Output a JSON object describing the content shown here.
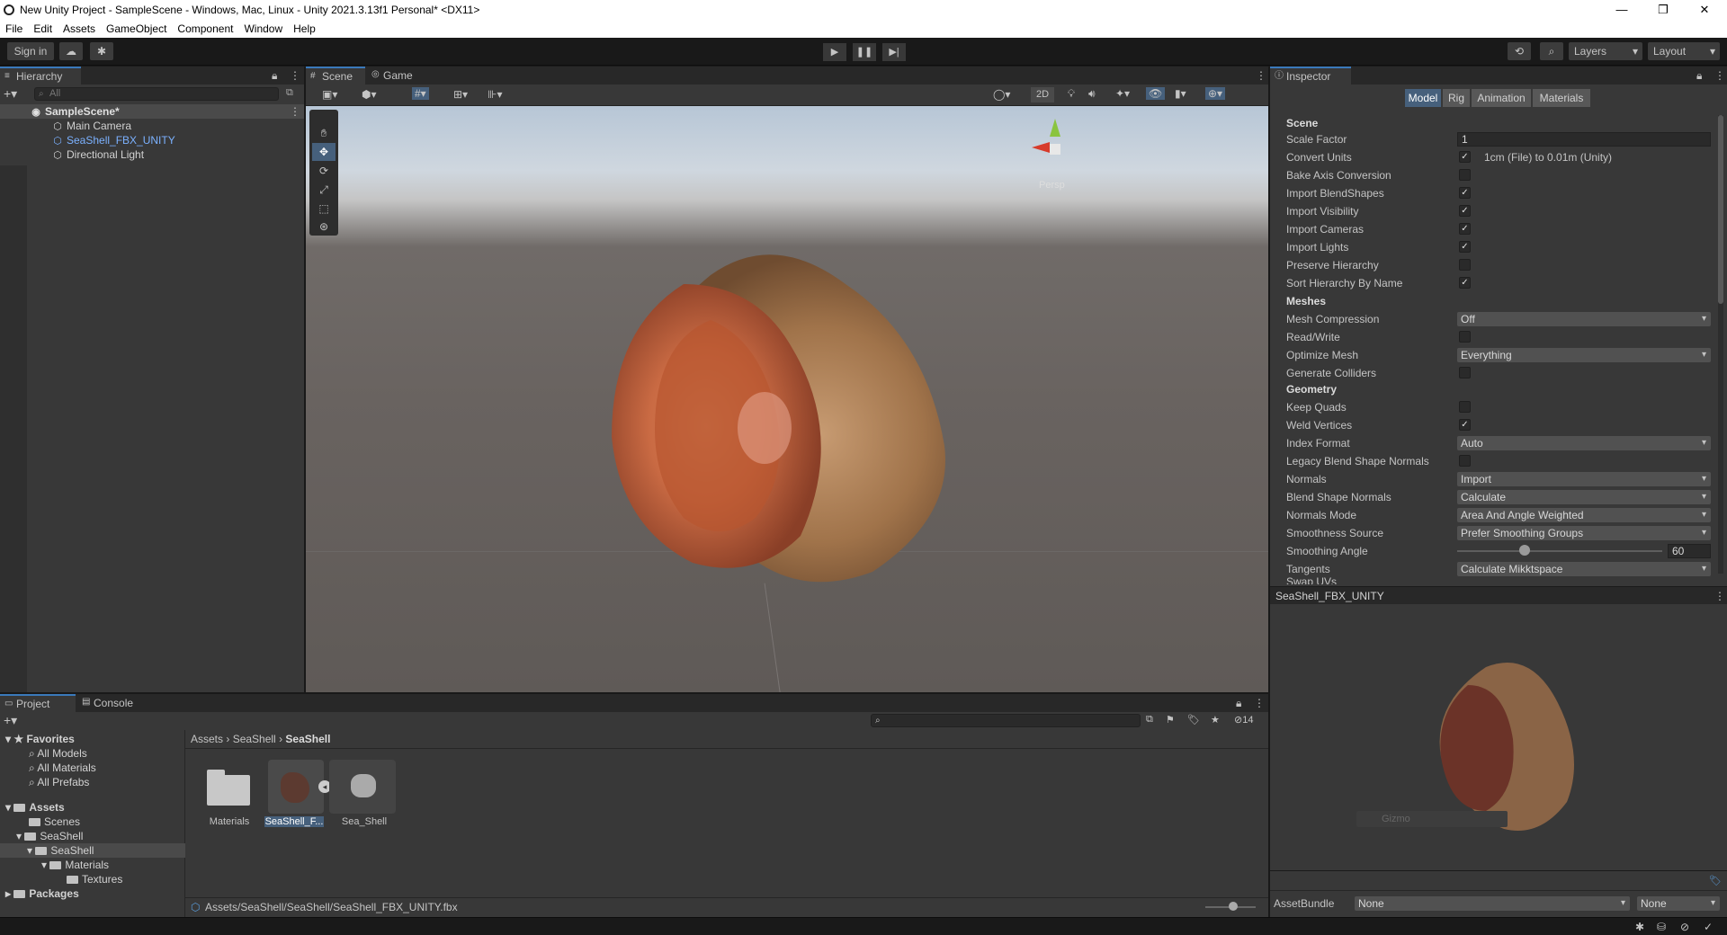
{
  "window": {
    "title": "New Unity Project - SampleScene - Windows, Mac, Linux - Unity 2021.3.13f1 Personal* <DX11>",
    "controls": [
      "—",
      "❐",
      "✕"
    ]
  },
  "menu": [
    "File",
    "Edit",
    "Assets",
    "GameObject",
    "Component",
    "Window",
    "Help"
  ],
  "toolbar": {
    "sign_in": "Sign in",
    "layers": "Layers",
    "layout": "Layout"
  },
  "hierarchy": {
    "tab": "Hierarchy",
    "search_placeholder": "All",
    "scene": "SampleScene*",
    "items": [
      "Main Camera",
      "SeaShell_FBX_UNITY",
      "Directional Light"
    ]
  },
  "scene_view": {
    "tabs": [
      "Scene",
      "Game"
    ],
    "toggle_2d": "2D",
    "gizmo_label": "Persp"
  },
  "inspector": {
    "tab": "Inspector",
    "subtabs": [
      "Model",
      "Rig",
      "Animation",
      "Materials"
    ],
    "scene_header": "Scene",
    "scale_factor_label": "Scale Factor",
    "scale_factor_value": "1",
    "convert_units_label": "Convert Units",
    "convert_units_note": "1cm (File) to 0.01m (Unity)",
    "bake_axis": "Bake Axis Conversion",
    "import_blendshapes": "Import BlendShapes",
    "import_visibility": "Import Visibility",
    "import_cameras": "Import Cameras",
    "import_lights": "Import Lights",
    "preserve_hierarchy": "Preserve Hierarchy",
    "sort_hierarchy": "Sort Hierarchy By Name",
    "meshes_header": "Meshes",
    "mesh_compression_label": "Mesh Compression",
    "mesh_compression_value": "Off",
    "read_write": "Read/Write",
    "optimize_mesh_label": "Optimize Mesh",
    "optimize_mesh_value": "Everything",
    "generate_colliders": "Generate Colliders",
    "geometry_header": "Geometry",
    "keep_quads": "Keep Quads",
    "weld_vertices": "Weld Vertices",
    "index_format_label": "Index Format",
    "index_format_value": "Auto",
    "legacy_blend": "Legacy Blend Shape Normals",
    "normals_label": "Normals",
    "normals_value": "Import",
    "blend_normals_label": "Blend Shape Normals",
    "blend_normals_value": "Calculate",
    "normals_mode_label": "Normals Mode",
    "normals_mode_value": "Area And Angle Weighted",
    "smoothness_label": "Smoothness Source",
    "smoothness_value": "Prefer Smoothing Groups",
    "smoothing_angle_label": "Smoothing Angle",
    "smoothing_angle_value": "60",
    "smoothing_angle_level": 0.33,
    "tangents_label": "Tangents",
    "tangents_value": "Calculate Mikktspace",
    "swap_uvs": "Swap UVs",
    "preview_title": "SeaShell_FBX_UNITY",
    "preview_overlay": "Gizmo",
    "assetbundle_label": "AssetBundle",
    "assetbundle_value": "None",
    "assetbundle_variant": "None"
  },
  "project": {
    "tabs": [
      "Project",
      "Console"
    ],
    "hidden_count": "14",
    "favorites_header": "Favorites",
    "favorites": [
      "All Models",
      "All Materials",
      "All Prefabs"
    ],
    "assets_header": "Assets",
    "tree": [
      "Scenes",
      "SeaShell",
      "SeaShell",
      "Materials",
      "Textures"
    ],
    "packages": "Packages",
    "breadcrumb": [
      "Assets",
      "SeaShell",
      "SeaShell"
    ],
    "files": [
      "Materials",
      "SeaShell_F...",
      "Sea_Shell"
    ],
    "status_path": "Assets/SeaShell/SeaShell/SeaShell_FBX_UNITY.fbx"
  },
  "colors": {
    "accent": "#3a79bb",
    "selected_text": "#7bb1ff",
    "panel": "#383838",
    "dark": "#191919"
  }
}
